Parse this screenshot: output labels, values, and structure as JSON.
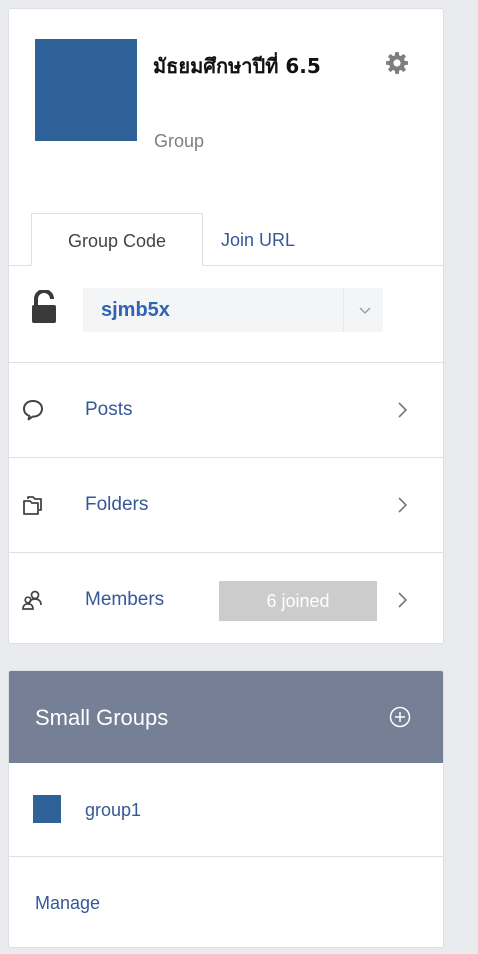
{
  "group": {
    "name": "มัธยมศึกษาปีที่ 6.5",
    "type": "Group",
    "thumb_color": "#2f6299",
    "settings_icon": "gear-icon"
  },
  "tabs": [
    {
      "label": "Group Code",
      "active": true
    },
    {
      "label": "Join URL",
      "active": false
    }
  ],
  "code": {
    "value": "sjmb5x",
    "lock_icon": "lock-icon",
    "dropdown_icon": "chevron-down-icon"
  },
  "nav": [
    {
      "label": "Posts",
      "icon": "chat-bubble-icon"
    },
    {
      "label": "Folders",
      "icon": "folders-icon"
    },
    {
      "label": "Members",
      "icon": "members-icon",
      "badge": "6 joined"
    }
  ],
  "small_groups": {
    "title": "Small Groups",
    "add_icon": "add-circle-icon",
    "items": [
      {
        "name": "group1",
        "color": "#2f6299"
      }
    ],
    "manage_label": "Manage"
  },
  "colors": {
    "link": "#365899",
    "code": "#2f63b3",
    "header_bar": "#757f95",
    "badge": "#cccccc"
  }
}
